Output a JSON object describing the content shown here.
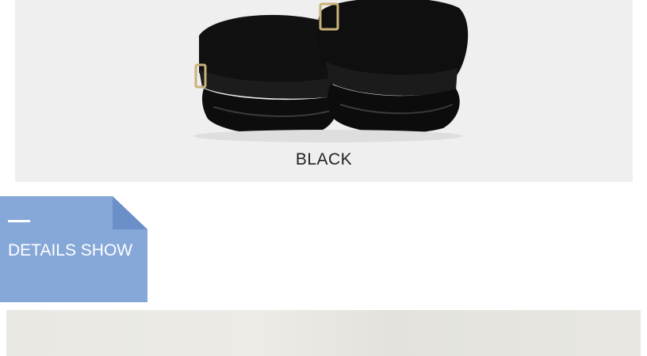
{
  "product": {
    "color_label": "BLACK",
    "image": "black-military-hats-photo"
  },
  "details_banner": {
    "title": "DETAILS SHOW",
    "accent_color": "#86a8d9",
    "fold_color": "#6b8fc8"
  },
  "detail_photo": {
    "image": "hat-detail-photo"
  }
}
